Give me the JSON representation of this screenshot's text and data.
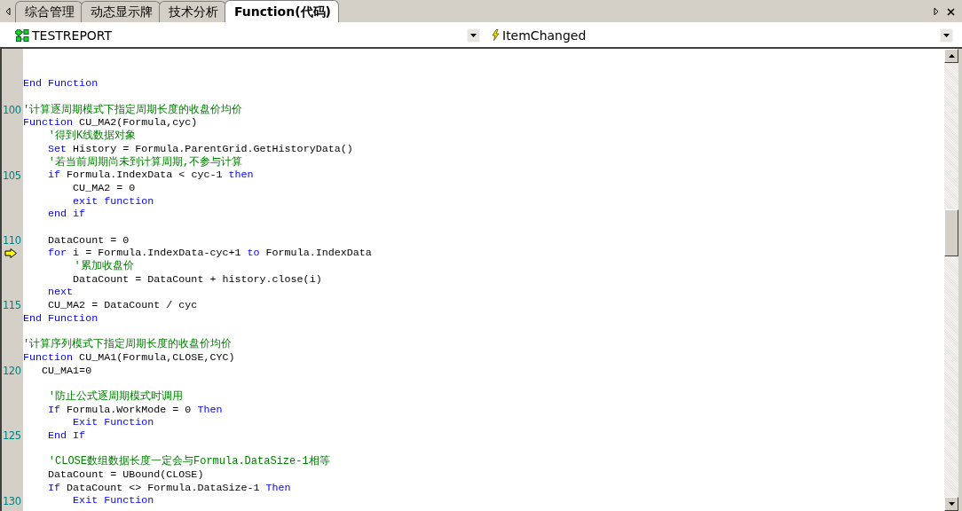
{
  "tabs": [
    {
      "label": "综合管理",
      "selected": false
    },
    {
      "label": "动态显示牌",
      "selected": false
    },
    {
      "label": "技术分析",
      "selected": false
    },
    {
      "label": "Function(代码)",
      "selected": true
    }
  ],
  "object_combo": {
    "value": "TESTREPORT"
  },
  "event_combo": {
    "value": "ItemChanged"
  },
  "code_lines": [
    {
      "kind": "blank",
      "current": false
    },
    {
      "kind": "blank",
      "current": false
    },
    {
      "kind": "code",
      "current": false,
      "segments": [
        {
          "kind": "keyword",
          "text": "End Function"
        }
      ]
    },
    {
      "kind": "blank",
      "current": false
    },
    {
      "kind": "code",
      "number": "100",
      "current": false,
      "segments": [
        {
          "kind": "comment",
          "text": "'计算逐周期模式下指定周期长度的收盘价均价"
        }
      ]
    },
    {
      "kind": "code",
      "current": false,
      "segments": [
        {
          "kind": "keyword",
          "text": "Function"
        },
        {
          "kind": "plain",
          "text": " CU_MA2(Formula,cyc)"
        }
      ]
    },
    {
      "kind": "code",
      "current": false,
      "segments": [
        {
          "kind": "comment",
          "text": "    '得到K线数据对象"
        }
      ]
    },
    {
      "kind": "code",
      "current": false,
      "segments": [
        {
          "kind": "keyword",
          "text": "    Set"
        },
        {
          "kind": "plain",
          "text": " History = Formula.ParentGrid.GetHistoryData()"
        }
      ]
    },
    {
      "kind": "code",
      "current": false,
      "segments": [
        {
          "kind": "comment",
          "text": "    '若当前周期尚未到计算周期,不参与计算"
        }
      ]
    },
    {
      "kind": "code",
      "number": "105",
      "current": false,
      "segments": [
        {
          "kind": "keyword",
          "text": "    if"
        },
        {
          "kind": "plain",
          "text": " Formula.IndexData < cyc-1 "
        },
        {
          "kind": "keyword",
          "text": "then"
        }
      ]
    },
    {
      "kind": "code",
      "current": false,
      "segments": [
        {
          "kind": "plain",
          "text": "        CU_MA2 = 0"
        }
      ]
    },
    {
      "kind": "code",
      "current": false,
      "segments": [
        {
          "kind": "keyword",
          "text": "        exit function"
        }
      ]
    },
    {
      "kind": "code",
      "current": false,
      "segments": [
        {
          "kind": "keyword",
          "text": "    end if"
        }
      ]
    },
    {
      "kind": "blank",
      "current": false
    },
    {
      "kind": "code",
      "number": "110",
      "current": false,
      "segments": [
        {
          "kind": "plain",
          "text": "    DataCount = 0"
        }
      ]
    },
    {
      "kind": "code",
      "current": true,
      "segments": [
        {
          "kind": "keyword",
          "text": "    for"
        },
        {
          "kind": "plain",
          "text": " i = Formula.IndexData-cyc+1 "
        },
        {
          "kind": "keyword",
          "text": "to"
        },
        {
          "kind": "plain",
          "text": " Formula.IndexData"
        }
      ]
    },
    {
      "kind": "code",
      "current": false,
      "segments": [
        {
          "kind": "comment",
          "text": "        '累加收盘价"
        }
      ]
    },
    {
      "kind": "code",
      "current": false,
      "segments": [
        {
          "kind": "plain",
          "text": "        DataCount = DataCount + history.close(i)"
        }
      ]
    },
    {
      "kind": "code",
      "current": false,
      "segments": [
        {
          "kind": "keyword",
          "text": "    next"
        }
      ]
    },
    {
      "kind": "code",
      "number": "115",
      "current": false,
      "segments": [
        {
          "kind": "plain",
          "text": "    CU_MA2 = DataCount / cyc"
        }
      ]
    },
    {
      "kind": "code",
      "current": false,
      "segments": [
        {
          "kind": "keyword",
          "text": "End Function"
        }
      ]
    },
    {
      "kind": "blank",
      "current": false
    },
    {
      "kind": "code",
      "current": false,
      "segments": [
        {
          "kind": "comment",
          "text": "'计算序列模式下指定周期长度的收盘价均价"
        }
      ]
    },
    {
      "kind": "code",
      "current": false,
      "segments": [
        {
          "kind": "keyword",
          "text": "Function"
        },
        {
          "kind": "plain",
          "text": " CU_MA1(Formula,CLOSE,CYC)"
        }
      ]
    },
    {
      "kind": "code",
      "number": "120",
      "current": false,
      "segments": [
        {
          "kind": "plain",
          "text": "   CU_MA1=0"
        }
      ]
    },
    {
      "kind": "blank",
      "current": false
    },
    {
      "kind": "code",
      "current": false,
      "segments": [
        {
          "kind": "comment",
          "text": "    '防止公式逐周期模式时调用"
        }
      ]
    },
    {
      "kind": "code",
      "current": false,
      "segments": [
        {
          "kind": "keyword",
          "text": "    If"
        },
        {
          "kind": "plain",
          "text": " Formula.WorkMode = 0 "
        },
        {
          "kind": "keyword",
          "text": "Then"
        }
      ]
    },
    {
      "kind": "code",
      "current": false,
      "segments": [
        {
          "kind": "keyword",
          "text": "        Exit Function"
        }
      ]
    },
    {
      "kind": "code",
      "number": "125",
      "current": false,
      "segments": [
        {
          "kind": "keyword",
          "text": "    End If"
        }
      ]
    },
    {
      "kind": "blank",
      "current": false
    },
    {
      "kind": "code",
      "current": false,
      "segments": [
        {
          "kind": "comment",
          "text": "    'CLOSE数组数据长度一定会与Formula.DataSize-1相等"
        }
      ]
    },
    {
      "kind": "code",
      "current": false,
      "segments": [
        {
          "kind": "plain",
          "text": "    DataCount = UBound(CLOSE)"
        }
      ]
    },
    {
      "kind": "code",
      "current": false,
      "segments": [
        {
          "kind": "keyword",
          "text": "    If"
        },
        {
          "kind": "plain",
          "text": " DataCount <> Formula.DataSize-1 "
        },
        {
          "kind": "keyword",
          "text": "Then"
        }
      ]
    },
    {
      "kind": "code",
      "number": "130",
      "current": false,
      "segments": [
        {
          "kind": "keyword",
          "text": "        Exit Function"
        }
      ]
    }
  ]
}
